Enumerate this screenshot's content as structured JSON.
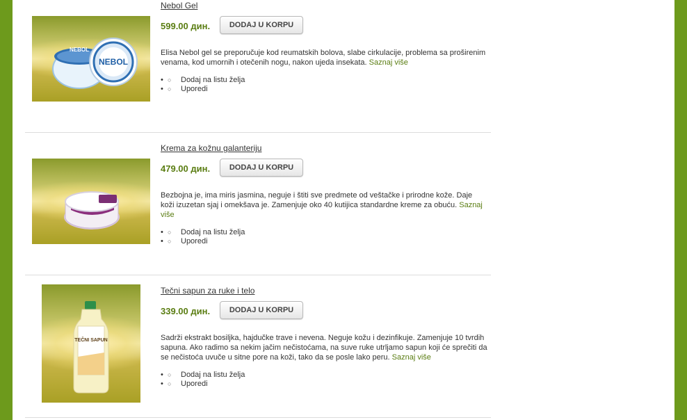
{
  "products": [
    {
      "title": "Nebol Gel",
      "price": "599.00 дин.",
      "button": "DODAJ U KORPU",
      "description": "Elisa Nebol gel se preporučuje kod reumatskih bolova, slabe cirkulacije, problema sa proširenim venama, kod umornih i otečenih nogu, nakon ujeda insekata.",
      "more": "Saznaj više",
      "image_label": "NEBOL",
      "actions": [
        "Dodaj na listu želja",
        "Uporedi"
      ]
    },
    {
      "title": "Krema za kožnu galanteriju",
      "price": "479.00 дин.",
      "button": "DODAJ U KORPU",
      "description": "Bezbojna je, ima miris jasmina, neguje i štiti sve predmete od veštačke i prirodne kože. Daje koži izuzetan sjaj i omekšava je. Zamenjuje oko 40 kutijica standardne kreme za obuću.",
      "more": "Saznaj više",
      "actions": [
        "Dodaj na listu želja",
        "Uporedi"
      ]
    },
    {
      "title": "Tečni sapun za ruke i telo",
      "price": "339.00 дин.",
      "button": "DODAJ U KORPU",
      "description": "Sadrži ekstrakt bosiljka, hajdučke trave i nevena. Neguje kožu i dezinfikuje. Zamenjuje 10 tvrdih sapuna. Ako radimo sa nekim jačim nečistoćama, na suve ruke utrljamo sapun koji će sprečiti da se nečistoća uvuče u sitne pore na koži, tako da se posle lako peru.",
      "more": "Saznaj više",
      "image_label": "TEČNI SAPUN",
      "actions": [
        "Dodaj na listu želja",
        "Uporedi"
      ]
    }
  ],
  "colors": {
    "frame_green": "#6d9a1c",
    "price_green": "#5a7d12",
    "link_green": "#5a7d12"
  }
}
